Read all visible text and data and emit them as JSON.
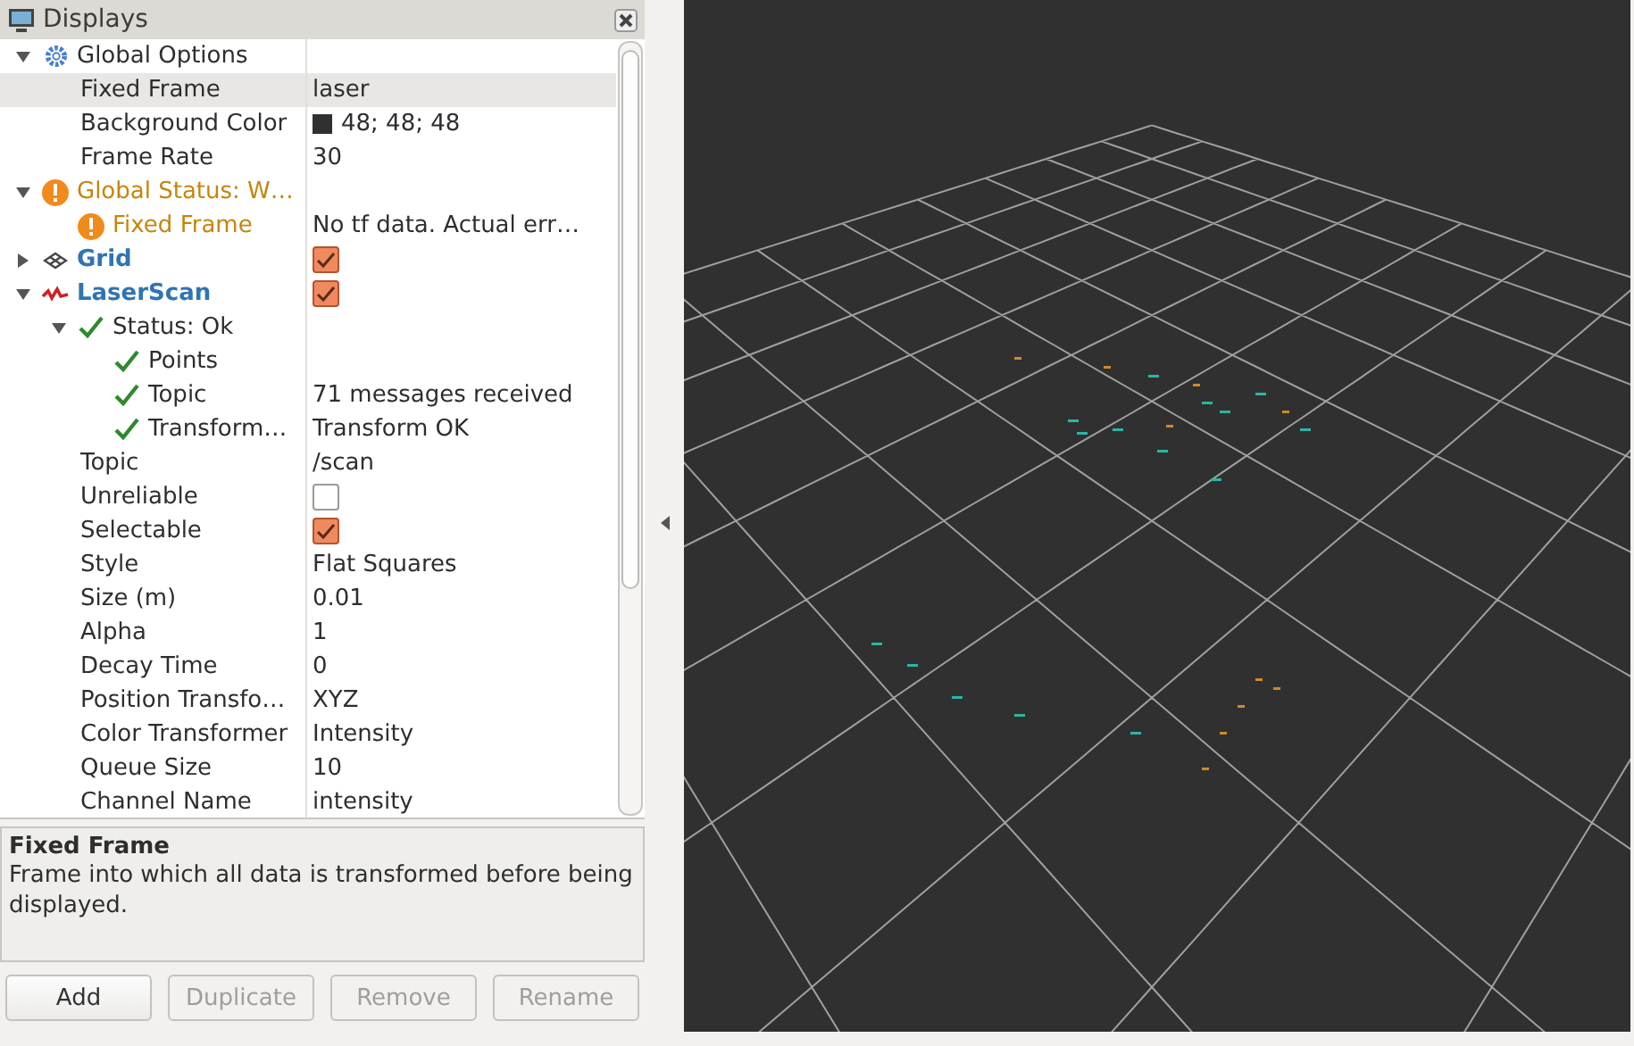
{
  "panel": {
    "title": "Displays"
  },
  "tree": [
    {
      "kind": "options",
      "label": "Global Options",
      "expanded": true,
      "selected": false,
      "children": [
        {
          "kind": "property",
          "label": "Fixed Frame",
          "value": "laser",
          "selected": true
        },
        {
          "kind": "property",
          "label": "Background Color",
          "value": "48; 48; 48",
          "color": "#303030",
          "selected": false
        },
        {
          "kind": "property",
          "label": "Frame Rate",
          "value": "30",
          "selected": false
        }
      ]
    },
    {
      "kind": "warning",
      "label": "Global Status: W…",
      "expanded": true,
      "selected": false,
      "children": [
        {
          "kind": "warning",
          "label": "Fixed Frame",
          "value": "No tf data.  Actual err…",
          "selected": false
        }
      ]
    },
    {
      "kind": "grid-display",
      "label": "Grid",
      "expanded": false,
      "checked": true,
      "selected": false
    },
    {
      "kind": "scan-display",
      "label": "LaserScan",
      "expanded": true,
      "checked": true,
      "selected": false,
      "children": [
        {
          "kind": "ok",
          "label": "Status: Ok",
          "expanded": true,
          "selected": false,
          "children": [
            {
              "kind": "ok",
              "label": "Points",
              "selected": false
            },
            {
              "kind": "ok",
              "label": "Topic",
              "value": "71 messages received",
              "selected": false
            },
            {
              "kind": "ok",
              "label": "Transform…",
              "value": "Transform OK",
              "selected": false
            }
          ]
        },
        {
          "kind": "property",
          "label": "Topic",
          "value": "/scan",
          "selected": false
        },
        {
          "kind": "property",
          "label": "Unreliable",
          "checked": false,
          "selected": false
        },
        {
          "kind": "property",
          "label": "Selectable",
          "checked": true,
          "selected": false
        },
        {
          "kind": "property",
          "label": "Style",
          "value": "Flat Squares",
          "selected": false
        },
        {
          "kind": "property",
          "label": "Size (m)",
          "value": "0.01",
          "selected": false
        },
        {
          "kind": "property",
          "label": "Alpha",
          "value": "1",
          "selected": false
        },
        {
          "kind": "property",
          "label": "Decay Time",
          "value": "0",
          "selected": false
        },
        {
          "kind": "property",
          "label": "Position Transfo…",
          "value": "XYZ",
          "selected": false
        },
        {
          "kind": "property",
          "label": "Color Transformer",
          "value": "Intensity",
          "selected": false
        },
        {
          "kind": "property",
          "label": "Queue Size",
          "value": "10",
          "selected": false
        },
        {
          "kind": "property",
          "label": "Channel Name",
          "value": "intensity",
          "selected": false
        }
      ]
    }
  ],
  "description": {
    "title": "Fixed Frame",
    "text": "Frame into which all data is transformed before being displayed."
  },
  "buttons": [
    {
      "label": "Add",
      "disabled": false
    },
    {
      "label": "Duplicate",
      "disabled": true
    },
    {
      "label": "Remove",
      "disabled": true
    },
    {
      "label": "Rename",
      "disabled": true
    }
  ]
}
